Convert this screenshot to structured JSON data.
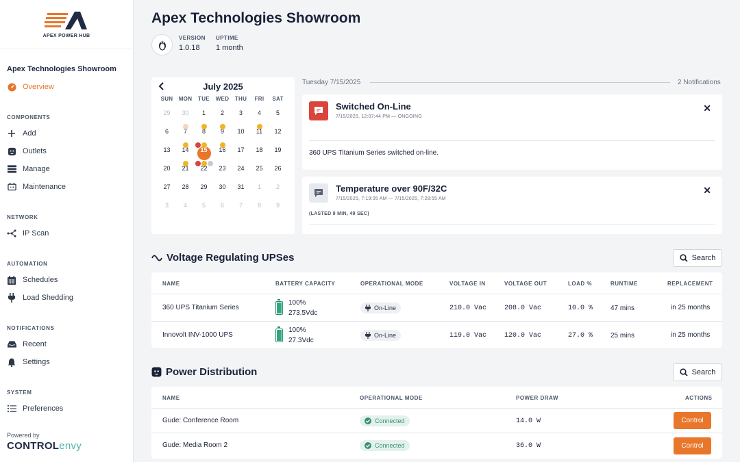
{
  "app": {
    "logo_text": "APEX POWER HUB",
    "site_name": "Apex Technologies Showroom",
    "powered_by": "Powered by",
    "brand_part1": "CONTROL",
    "brand_part2": "envy",
    "accent_color": "#e8762b"
  },
  "sidebar": {
    "overview": "Overview",
    "sections": {
      "components": "COMPONENTS",
      "network": "NETWORK",
      "automation": "AUTOMATION",
      "notifications": "NOTIFICATIONS",
      "system": "SYSTEM"
    },
    "items": {
      "add": "Add",
      "outlets": "Outlets",
      "manage": "Manage",
      "maintenance": "Maintenance",
      "ip_scan": "IP Scan",
      "schedules": "Schedules",
      "load_shedding": "Load Shedding",
      "recent": "Recent",
      "settings": "Settings",
      "preferences": "Preferences"
    }
  },
  "header": {
    "title": "Apex Technologies Showroom",
    "version_label": "VERSION",
    "version": "1.0.18",
    "uptime_label": "UPTIME",
    "uptime": "1 month"
  },
  "calendar": {
    "month": "July 2025",
    "dow": [
      "SUN",
      "MON",
      "TUE",
      "WED",
      "THU",
      "FRI",
      "SAT"
    ],
    "weeks": [
      [
        "29",
        "30",
        "1",
        "2",
        "3",
        "4",
        "5"
      ],
      [
        "6",
        "7",
        "8",
        "9",
        "10",
        "11",
        "12"
      ],
      [
        "13",
        "14",
        "15",
        "16",
        "17",
        "18",
        "19"
      ],
      [
        "20",
        "21",
        "22",
        "23",
        "24",
        "25",
        "26"
      ],
      [
        "27",
        "28",
        "29",
        "30",
        "31",
        "1",
        "2"
      ],
      [
        "3",
        "4",
        "5",
        "6",
        "7",
        "8",
        "9"
      ]
    ],
    "today": "15"
  },
  "notifications": {
    "date": "Tuesday 7/15/2025",
    "count": "2 Notifications",
    "items": [
      {
        "title": "Switched On-Line",
        "time": "7/15/2025, 12:07:44 PM  —  ONGOING",
        "body": "360 UPS Titanium Series switched on-line."
      },
      {
        "title": "Temperature over 90F/32C",
        "time": "7/15/2025, 7:19:05 AM  —  7/15/2025, 7:28:55 AM",
        "body": "(LASTED 9 MIN, 49 SEC)"
      }
    ]
  },
  "ups": {
    "title": "Voltage Regulating UPSes",
    "search": "Search",
    "headers": [
      "NAME",
      "BATTERY CAPACITY",
      "OPERATIONAL MODE",
      "VOLTAGE IN",
      "VOLTAGE OUT",
      "LOAD %",
      "RUNTIME",
      "REPLACEMENT"
    ],
    "rows": [
      {
        "name": "360 UPS Titanium Series",
        "battery_pct": "100%",
        "battery_v": "273.5Vdc",
        "battery_level": 1.0,
        "mode": "On-Line",
        "v_in": "210.0 Vac",
        "v_out": "208.0 Vac",
        "load": "10.0 %",
        "runtime": "47 mins",
        "replacement": "in 25 months"
      },
      {
        "name": "Innovolt INV-1000 UPS",
        "battery_pct": "100%",
        "battery_v": "27.3Vdc",
        "battery_level": 1.0,
        "mode": "On-Line",
        "v_in": "119.0 Vac",
        "v_out": "120.0 Vac",
        "load": "27.0 %",
        "runtime": "25 mins",
        "replacement": "in 25 months"
      }
    ]
  },
  "pdu": {
    "title": "Power Distribution",
    "search": "Search",
    "headers": [
      "NAME",
      "OPERATIONAL MODE",
      "POWER DRAW",
      "ACTIONS"
    ],
    "rows": [
      {
        "name": "Gude: Conference Room",
        "mode": "Connected",
        "power": "14.0 W",
        "action": "Control"
      },
      {
        "name": "Gude: Media Room 2",
        "mode": "Connected",
        "power": "36.0 W",
        "action": "Control"
      }
    ]
  }
}
